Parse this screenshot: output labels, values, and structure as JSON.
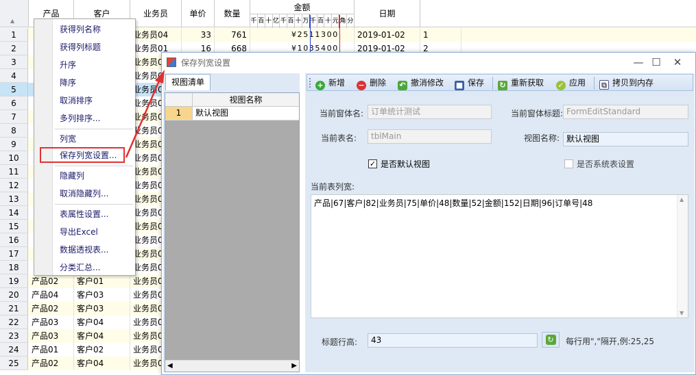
{
  "grid": {
    "headers": {
      "product": "产品",
      "customer": "客户",
      "salesman": "业务员",
      "price": "单价",
      "qty": "数量",
      "amount": "金额",
      "date": "日期"
    },
    "digit_labels": [
      "千",
      "百",
      "十",
      "亿",
      "千",
      "百",
      "十",
      "万",
      "千",
      "百",
      "十",
      "元",
      "角",
      "分"
    ],
    "rows": [
      {
        "n": "1",
        "product": "",
        "customer": "",
        "salesman": "业务员04",
        "price": "33",
        "qty": "761",
        "amount": "¥2511300",
        "date": "2019-01-02",
        "extra": "1"
      },
      {
        "n": "2",
        "product": "",
        "customer": "",
        "salesman": "业务员01",
        "price": "16",
        "qty": "668",
        "amount": "¥1035400",
        "date": "2019-01-02",
        "extra": "2"
      },
      {
        "n": "3",
        "product": "",
        "customer": "",
        "salesman": "业务员0",
        "price": "",
        "qty": "",
        "amount": "",
        "date": "",
        "extra": ""
      },
      {
        "n": "4",
        "product": "",
        "customer": "",
        "salesman": "业务员0",
        "price": "",
        "qty": "",
        "amount": "",
        "date": "",
        "extra": ""
      },
      {
        "n": "5",
        "product": "",
        "customer": "",
        "salesman": "业务员0",
        "price": "",
        "qty": "",
        "amount": "",
        "date": "",
        "extra": ""
      },
      {
        "n": "6",
        "product": "",
        "customer": "",
        "salesman": "业务员0",
        "price": "",
        "qty": "",
        "amount": "",
        "date": "",
        "extra": ""
      },
      {
        "n": "7",
        "product": "",
        "customer": "",
        "salesman": "业务员0",
        "price": "",
        "qty": "",
        "amount": "",
        "date": "",
        "extra": ""
      },
      {
        "n": "8",
        "product": "",
        "customer": "",
        "salesman": "业务员0",
        "price": "",
        "qty": "",
        "amount": "",
        "date": "",
        "extra": ""
      },
      {
        "n": "9",
        "product": "",
        "customer": "",
        "salesman": "业务员0",
        "price": "",
        "qty": "",
        "amount": "",
        "date": "",
        "extra": ""
      },
      {
        "n": "10",
        "product": "",
        "customer": "",
        "salesman": "业务员0",
        "price": "",
        "qty": "",
        "amount": "",
        "date": "",
        "extra": ""
      },
      {
        "n": "11",
        "product": "",
        "customer": "",
        "salesman": "业务员0",
        "price": "",
        "qty": "",
        "amount": "",
        "date": "",
        "extra": ""
      },
      {
        "n": "12",
        "product": "",
        "customer": "",
        "salesman": "业务员0",
        "price": "",
        "qty": "",
        "amount": "",
        "date": "",
        "extra": ""
      },
      {
        "n": "13",
        "product": "",
        "customer": "",
        "salesman": "业务员0",
        "price": "",
        "qty": "",
        "amount": "",
        "date": "",
        "extra": ""
      },
      {
        "n": "14",
        "product": "",
        "customer": "",
        "salesman": "业务员0",
        "price": "",
        "qty": "",
        "amount": "",
        "date": "",
        "extra": ""
      },
      {
        "n": "15",
        "product": "",
        "customer": "",
        "salesman": "业务员0",
        "price": "",
        "qty": "",
        "amount": "",
        "date": "",
        "extra": ""
      },
      {
        "n": "16",
        "product": "",
        "customer": "",
        "salesman": "业务员0",
        "price": "",
        "qty": "",
        "amount": "",
        "date": "",
        "extra": ""
      },
      {
        "n": "17",
        "product": "",
        "customer": "",
        "salesman": "业务员0",
        "price": "",
        "qty": "",
        "amount": "",
        "date": "",
        "extra": ""
      },
      {
        "n": "18",
        "product": "",
        "customer": "",
        "salesman": "业务员0",
        "price": "",
        "qty": "",
        "amount": "",
        "date": "",
        "extra": ""
      },
      {
        "n": "19",
        "product": "产品02",
        "customer": "客户01",
        "salesman": "业务员0",
        "price": "",
        "qty": "",
        "amount": "",
        "date": "",
        "extra": ""
      },
      {
        "n": "20",
        "product": "产品04",
        "customer": "客户03",
        "salesman": "业务员0",
        "price": "",
        "qty": "",
        "amount": "",
        "date": "",
        "extra": ""
      },
      {
        "n": "21",
        "product": "产品02",
        "customer": "客户03",
        "salesman": "业务员0",
        "price": "",
        "qty": "",
        "amount": "",
        "date": "",
        "extra": ""
      },
      {
        "n": "22",
        "product": "产品03",
        "customer": "客户04",
        "salesman": "业务员0",
        "price": "",
        "qty": "",
        "amount": "",
        "date": "",
        "extra": ""
      },
      {
        "n": "23",
        "product": "产品03",
        "customer": "客户04",
        "salesman": "业务员0",
        "price": "",
        "qty": "",
        "amount": "",
        "date": "",
        "extra": ""
      },
      {
        "n": "24",
        "product": "产品01",
        "customer": "客户02",
        "salesman": "业务员0",
        "price": "",
        "qty": "",
        "amount": "",
        "date": "",
        "extra": ""
      },
      {
        "n": "25",
        "product": "产品02",
        "customer": "客户04",
        "salesman": "业务员0",
        "price": "",
        "qty": "",
        "amount": "",
        "date": "",
        "extra": ""
      }
    ]
  },
  "context_menu": {
    "items": [
      {
        "label": "获得列名称",
        "name": "menu-get-column-name"
      },
      {
        "label": "获得列标题",
        "name": "menu-get-column-title"
      },
      {
        "label": "升序",
        "name": "menu-sort-asc"
      },
      {
        "label": "降序",
        "name": "menu-sort-desc"
      },
      {
        "label": "取消排序",
        "name": "menu-cancel-sort"
      },
      {
        "label": "多列排序...",
        "name": "menu-multi-sort"
      },
      {
        "label": "列宽",
        "name": "menu-column-width"
      },
      {
        "label": "保存列宽设置...",
        "name": "menu-save-column-width"
      },
      {
        "label": "隐藏列",
        "name": "menu-hide-column"
      },
      {
        "label": "取消隐藏列...",
        "name": "menu-unhide-column"
      },
      {
        "label": "表属性设置...",
        "name": "menu-table-properties"
      },
      {
        "label": "导出Excel",
        "name": "menu-export-excel"
      },
      {
        "label": "数据透视表...",
        "name": "menu-pivot-table"
      },
      {
        "label": "分类汇总...",
        "name": "menu-subtotal"
      }
    ]
  },
  "dialog": {
    "title": "保存列宽设置",
    "tab_label": "视图清单",
    "view_list": {
      "header": "视图名称",
      "rows": [
        {
          "n": "1",
          "name": "默认视图"
        }
      ]
    },
    "toolbar": {
      "add": "新增",
      "delete": "删除",
      "undo": "撤消修改",
      "save": "保存",
      "refetch": "重新获取",
      "apply": "应用",
      "copy": "拷贝到内存"
    },
    "form": {
      "form_name_label": "当前窗体名:",
      "form_name_value": "订单统计测试",
      "form_title_label": "当前窗体标题:",
      "form_title_value": "FormEditStandard",
      "table_name_label": "当前表名:",
      "table_name_value": "tblMain",
      "view_name_label": "视图名称:",
      "view_name_value": "默认视图",
      "default_view_label": "是否默认视图",
      "default_view_checked": "✓",
      "system_table_label": "是否系统表设置",
      "col_width_label": "当前表列宽:",
      "col_width_value": "产品|67|客户|82|业务员|75|单价|48|数量|52|金额|152|日期|96|订单号|48",
      "title_height_label": "标题行高:",
      "title_height_value": "43",
      "hint": "每行用\",\"隔开,例:25,25"
    }
  },
  "colors": {
    "accent_red": "#e23030",
    "dialog_border": "#8aaed0",
    "selected_row": "#c6e4f6"
  }
}
